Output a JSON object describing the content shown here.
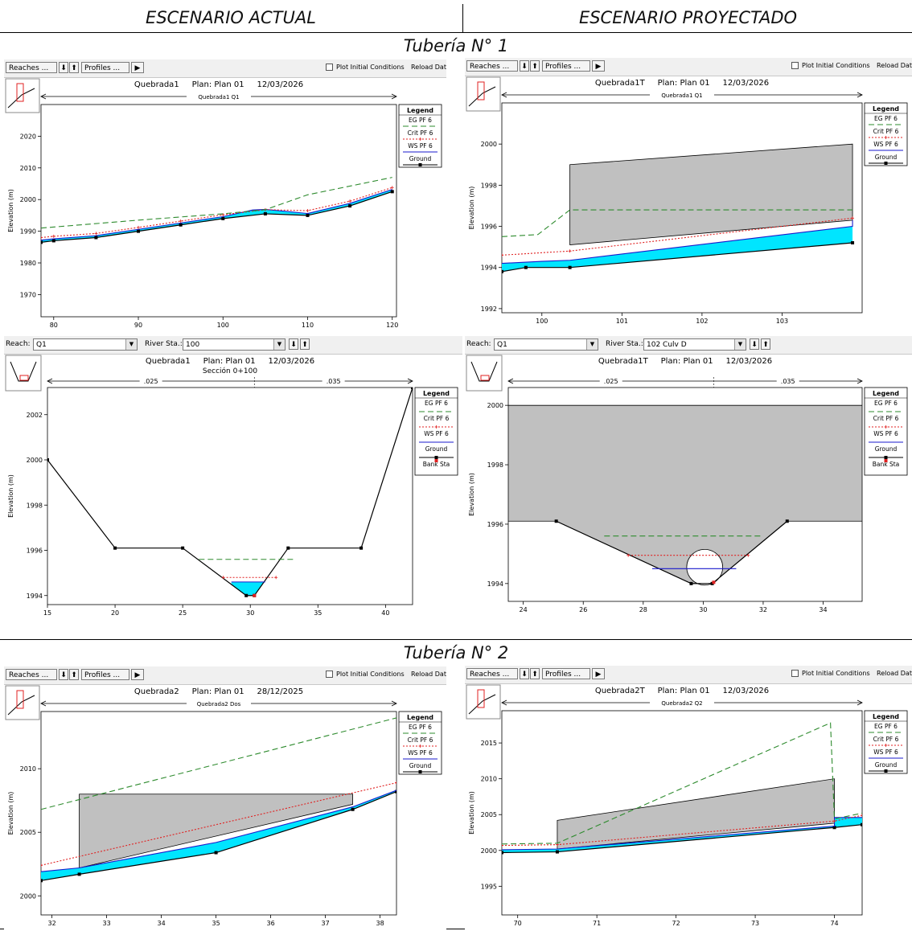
{
  "header": {
    "cut_text": "",
    "col_left": "ESCENARIO ACTUAL",
    "col_right": "ESCENARIO PROYECTADO",
    "section1": "Tubería N° 1",
    "section2": "Tubería N° 2"
  },
  "toolbar_profile": {
    "reaches_label": "Reaches ...",
    "profiles_label": "Profiles ...",
    "plot_initial_label": "Plot Initial Conditions",
    "reload_label": "Reload Dat"
  },
  "toolbar_xs": {
    "reach_label": "Reach:",
    "reach_value": "Q1",
    "river_sta_label": "River Sta.:"
  },
  "colors": {
    "eg": "#2e8b2e",
    "crit": "#e02020",
    "ws": "#1a1acc",
    "water": "#00e5ff",
    "culvert": "#c0c0c0",
    "ground": "#000000"
  },
  "chart_data": [
    {
      "id": "p1",
      "type": "line",
      "toolbar": "profile",
      "title": "Quebrada1     Plan: Plan 01     12/03/2026",
      "subtitle": "",
      "reach_label": "Quebrada1 Q1",
      "ylabel": "Elevation (m)",
      "xlim": [
        78.5,
        120.5
      ],
      "ylim": [
        1963,
        2030
      ],
      "xticks": [
        80,
        90,
        100,
        110,
        120
      ],
      "yticks": [
        1970,
        1980,
        1990,
        2000,
        2010,
        2020
      ],
      "legend": [
        "EG PF 6",
        "Crit PF 6",
        "WS PF 6",
        "Ground"
      ],
      "water_fill": true,
      "series": [
        {
          "role": "ground",
          "name": "Ground",
          "x": [
            78.5,
            80,
            85,
            90,
            95,
            100,
            105,
            110,
            115,
            120
          ],
          "y": [
            1986.5,
            1987,
            1988,
            1990,
            1992,
            1994,
            1995.5,
            1995,
            1998,
            2002.5
          ],
          "markers": true
        },
        {
          "role": "ws",
          "name": "WS PF 6",
          "x": [
            78.5,
            80,
            85,
            90,
            95,
            100,
            103.5,
            105,
            110,
            115,
            120
          ],
          "y": [
            1987.2,
            1987.6,
            1988.6,
            1990.6,
            1992.6,
            1994.6,
            1996.7,
            1996.9,
            1995.6,
            1998.8,
            2003.2
          ]
        },
        {
          "role": "crit",
          "name": "Crit PF 6",
          "x": [
            78.5,
            80,
            85,
            90,
            95,
            100,
            105,
            110,
            115,
            120
          ],
          "y": [
            1988,
            1988.4,
            1989.3,
            1991.2,
            1993.2,
            1995.2,
            1996.8,
            1996.5,
            1999.5,
            2003.8
          ]
        },
        {
          "role": "eg",
          "name": "EG PF 6",
          "x": [
            78.5,
            90,
            100,
            105,
            110,
            120
          ],
          "y": [
            1991,
            1993.5,
            1995.5,
            1996.8,
            2001.5,
            2007
          ]
        }
      ]
    },
    {
      "id": "p2",
      "type": "line",
      "toolbar": "profile",
      "title": "Quebrada1T     Plan: Plan 01     12/03/2026",
      "subtitle": "",
      "reach_label": "Quebrada1 Q1",
      "ylabel": "Elevation (m)",
      "xlim": [
        99.5,
        104
      ],
      "ylim": [
        1991.8,
        2002
      ],
      "xticks": [
        100,
        101,
        102,
        103
      ],
      "yticks": [
        1992,
        1994,
        1996,
        1998,
        2000
      ],
      "legend": [
        "EG PF 6",
        "Crit PF 6",
        "WS PF 6",
        "Ground"
      ],
      "water_fill": true,
      "culvert": {
        "x0": 100.35,
        "x1": 103.88,
        "top0": 1999,
        "top1": 2000,
        "bot0": 1995.1,
        "bot1": 1996.3
      },
      "series": [
        {
          "role": "ground",
          "name": "Ground",
          "x": [
            99.5,
            99.8,
            100.35,
            103.88
          ],
          "y": [
            1993.8,
            1994.0,
            1994.0,
            1995.2
          ],
          "markers": true
        },
        {
          "role": "ws",
          "name": "WS PF 6",
          "x": [
            99.5,
            100,
            100.35,
            103.88,
            103.88
          ],
          "y": [
            1994.2,
            1994.3,
            1994.35,
            1996.0,
            1996.3
          ]
        },
        {
          "role": "crit",
          "name": "Crit PF 6",
          "x": [
            99.5,
            100.35,
            103.88
          ],
          "y": [
            1994.6,
            1994.8,
            1996.4
          ]
        },
        {
          "role": "eg",
          "name": "EG PF 6",
          "x": [
            99.5,
            99.95,
            100.35,
            103.88
          ],
          "y": [
            1995.5,
            1995.6,
            1996.8,
            1996.8
          ]
        }
      ]
    },
    {
      "id": "x1",
      "type": "line",
      "toolbar": "xs",
      "river_sta_value": "100",
      "title": "Quebrada1     Plan: Plan 01     12/03/2026",
      "subtitle": "Sección 0+100",
      "ylabel": "Elevation (m)",
      "xlim": [
        15,
        42
      ],
      "ylim": [
        1993.6,
        2003.2
      ],
      "xticks": [
        15,
        20,
        25,
        30,
        35,
        40
      ],
      "yticks": [
        1994,
        1996,
        1998,
        2000,
        2002
      ],
      "legend": [
        "EG PF 6",
        "Crit PF 6",
        "WS PF 6",
        "Ground",
        "Bank Sta"
      ],
      "n_values": [
        ".025",
        ".035"
      ],
      "bank_x": 30.3,
      "water": {
        "x": [
          28.6,
          31.1
        ],
        "y": 1994.6
      },
      "series": [
        {
          "role": "ground",
          "name": "Ground",
          "x": [
            15,
            20,
            25,
            29.7,
            30.3,
            32.8,
            38.2,
            42
          ],
          "y": [
            2000,
            1996.1,
            1996.1,
            1994,
            1994,
            1996.1,
            1996.1,
            2003.2
          ],
          "markers": true
        },
        {
          "role": "eg",
          "name": "EG PF 6",
          "x": [
            26.2,
            33.3
          ],
          "y": [
            1995.6,
            1995.6
          ]
        },
        {
          "role": "crit",
          "name": "Crit PF 6",
          "x": [
            28.0,
            31.9
          ],
          "y": [
            1994.8,
            1994.8
          ]
        },
        {
          "role": "ws",
          "name": "WS PF 6",
          "x": [
            28.6,
            31.1
          ],
          "y": [
            1994.6,
            1994.6
          ]
        }
      ]
    },
    {
      "id": "x2",
      "type": "line",
      "toolbar": "xs",
      "river_sta_value": "102   Culv D",
      "title": "Quebrada1T     Plan: Plan 01     12/03/2026",
      "subtitle": "",
      "ylabel": "Elevation (m)",
      "xlim": [
        23.5,
        35.3
      ],
      "ylim": [
        1993.4,
        2000.6
      ],
      "xticks": [
        24,
        26,
        28,
        30,
        32,
        34
      ],
      "yticks": [
        1994,
        1996,
        1998,
        2000
      ],
      "legend": [
        "EG PF 6",
        "Crit PF 6",
        "WS PF 6",
        "Ground",
        "Bank Sta"
      ],
      "n_values": [
        ".025",
        ".035"
      ],
      "deck": {
        "x0": 23.5,
        "x1": 35.3,
        "top": 2000,
        "bottom": 1996.1
      },
      "pipe": {
        "cx": 30.05,
        "cy": 1994.55,
        "r": 0.6
      },
      "water": {
        "x": [
          29.55,
          30.6
        ],
        "y": 1994.5
      },
      "bank_x": 30.35,
      "series": [
        {
          "role": "ground",
          "name": "Ground",
          "x": [
            25.1,
            29.6,
            30.3,
            32.8
          ],
          "y": [
            1996.1,
            1994,
            1994,
            1996.1
          ],
          "markers": true
        },
        {
          "role": "eg",
          "name": "EG PF 6",
          "x": [
            26.7,
            32.0
          ],
          "y": [
            1995.6,
            1995.6
          ]
        },
        {
          "role": "crit",
          "name": "Crit PF 6",
          "x": [
            27.5,
            31.5
          ],
          "y": [
            1994.95,
            1994.95
          ]
        },
        {
          "role": "ws",
          "name": "WS PF 6",
          "x": [
            28.3,
            31.1
          ],
          "y": [
            1994.5,
            1994.5
          ]
        }
      ]
    },
    {
      "id": "p3",
      "type": "line",
      "toolbar": "profile",
      "title": "Quebrada2     Plan: Plan 01     28/12/2025",
      "subtitle": "",
      "reach_label": "Quebrada2 Dos",
      "ylabel": "Elevation (m)",
      "xlim": [
        31.8,
        38.3
      ],
      "ylim": [
        1998.5,
        2014.5
      ],
      "xticks": [
        32,
        33,
        34,
        35,
        36,
        37,
        38
      ],
      "yticks": [
        2000,
        2005,
        2010
      ],
      "legend": [
        "EG PF 6",
        "Crit PF 6",
        "WS PF 6",
        "Ground"
      ],
      "water_fill": true,
      "culvert": {
        "x0": 32.5,
        "x1": 37.5,
        "top0": 2008,
        "top1": 2008,
        "bot0": 2002.2,
        "bot1": 2007.2
      },
      "series": [
        {
          "role": "ground",
          "name": "Ground",
          "x": [
            31.8,
            32.5,
            35,
            37.5,
            38.3
          ],
          "y": [
            2001.2,
            2001.7,
            2003.4,
            2006.8,
            2008.2
          ],
          "markers": true
        },
        {
          "role": "ws",
          "name": "WS PF 6",
          "x": [
            31.8,
            32.5,
            35,
            37.5,
            38.3
          ],
          "y": [
            2001.9,
            2002.2,
            2004.2,
            2007.0,
            2008.3
          ]
        },
        {
          "role": "crit",
          "name": "Crit PF 6",
          "x": [
            31.8,
            38.3
          ],
          "y": [
            2002.4,
            2008.9
          ]
        },
        {
          "role": "eg",
          "name": "EG PF 6",
          "x": [
            31.8,
            38.3
          ],
          "y": [
            2006.8,
            2014.0
          ]
        }
      ]
    },
    {
      "id": "p4",
      "type": "line",
      "toolbar": "profile",
      "title": "Quebrada2T     Plan: Plan 01     12/03/2026",
      "subtitle": "",
      "reach_label": "Quebrada2 Q2",
      "ylabel": "Elevation (m)",
      "xlim": [
        69.8,
        74.35
      ],
      "ylim": [
        1991,
        2019.5
      ],
      "xticks": [
        70,
        71,
        72,
        73,
        74
      ],
      "yticks": [
        1995,
        2000,
        2005,
        2010,
        2015
      ],
      "legend": [
        "EG PF 6",
        "Crit PF 6",
        "WS PF 6",
        "Ground"
      ],
      "water_fill": true,
      "culvert": {
        "x0": 70.5,
        "x1": 74.0,
        "top0": 2004.2,
        "top1": 2010,
        "bot0": 2000.2,
        "bot1": 2003.8
      },
      "series": [
        {
          "role": "ground",
          "name": "Ground",
          "x": [
            69.8,
            70.5,
            74.0,
            74.35
          ],
          "y": [
            1999.7,
            1999.8,
            2003.2,
            2003.6
          ],
          "markers": true
        },
        {
          "role": "ws",
          "name": "WS PF 6",
          "x": [
            69.8,
            70.5,
            74.0,
            74.0,
            74.35
          ],
          "y": [
            2000.1,
            2000.2,
            2003.4,
            2004.6,
            2004.6
          ]
        },
        {
          "role": "crit",
          "name": "Crit PF 6",
          "x": [
            69.8,
            70.5,
            74.0,
            74.35
          ],
          "y": [
            2000.7,
            2000.8,
            2004.1,
            2004.9
          ]
        },
        {
          "role": "eg",
          "name": "EG PF 6",
          "x": [
            69.8,
            70.5,
            73.95,
            74.0,
            74.35
          ],
          "y": [
            2000.9,
            2001,
            2017.8,
            2004.4,
            2005.2
          ]
        }
      ]
    }
  ]
}
